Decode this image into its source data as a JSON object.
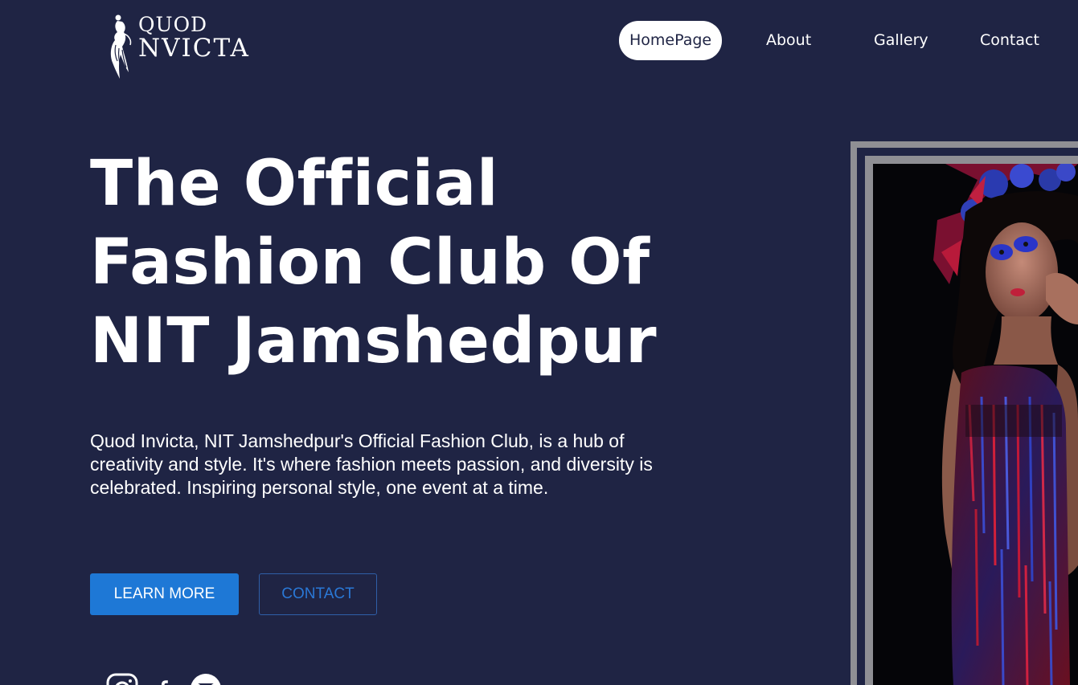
{
  "logo": {
    "line1": "QUOD",
    "line2": "NVICTA",
    "icon": "fashion-figure-logo"
  },
  "nav": {
    "items": [
      {
        "label": "HomePage",
        "active": true
      },
      {
        "label": "About",
        "active": false
      },
      {
        "label": "Gallery",
        "active": false
      },
      {
        "label": "Contact",
        "active": false
      }
    ]
  },
  "hero": {
    "title": "The Official Fashion Club Of NIT Jamshedpur",
    "description": "Quod Invicta, NIT Jamshedpur's Official Fashion Club, is a hub of creativity and style. It's where fashion meets passion, and diversity is celebrated. Inspiring personal style, one event at a time.",
    "primary_button": "LEARN MORE",
    "secondary_button": "CONTACT"
  },
  "social": {
    "icons": [
      "instagram-icon",
      "facebook-icon",
      "email-icon"
    ]
  },
  "photo": {
    "subject": "model-portrait-photo"
  },
  "colors": {
    "background": "#1f2444",
    "primary_button": "#1e78d6",
    "outline_text": "#2a78d6",
    "frame": "#8f8f94"
  }
}
